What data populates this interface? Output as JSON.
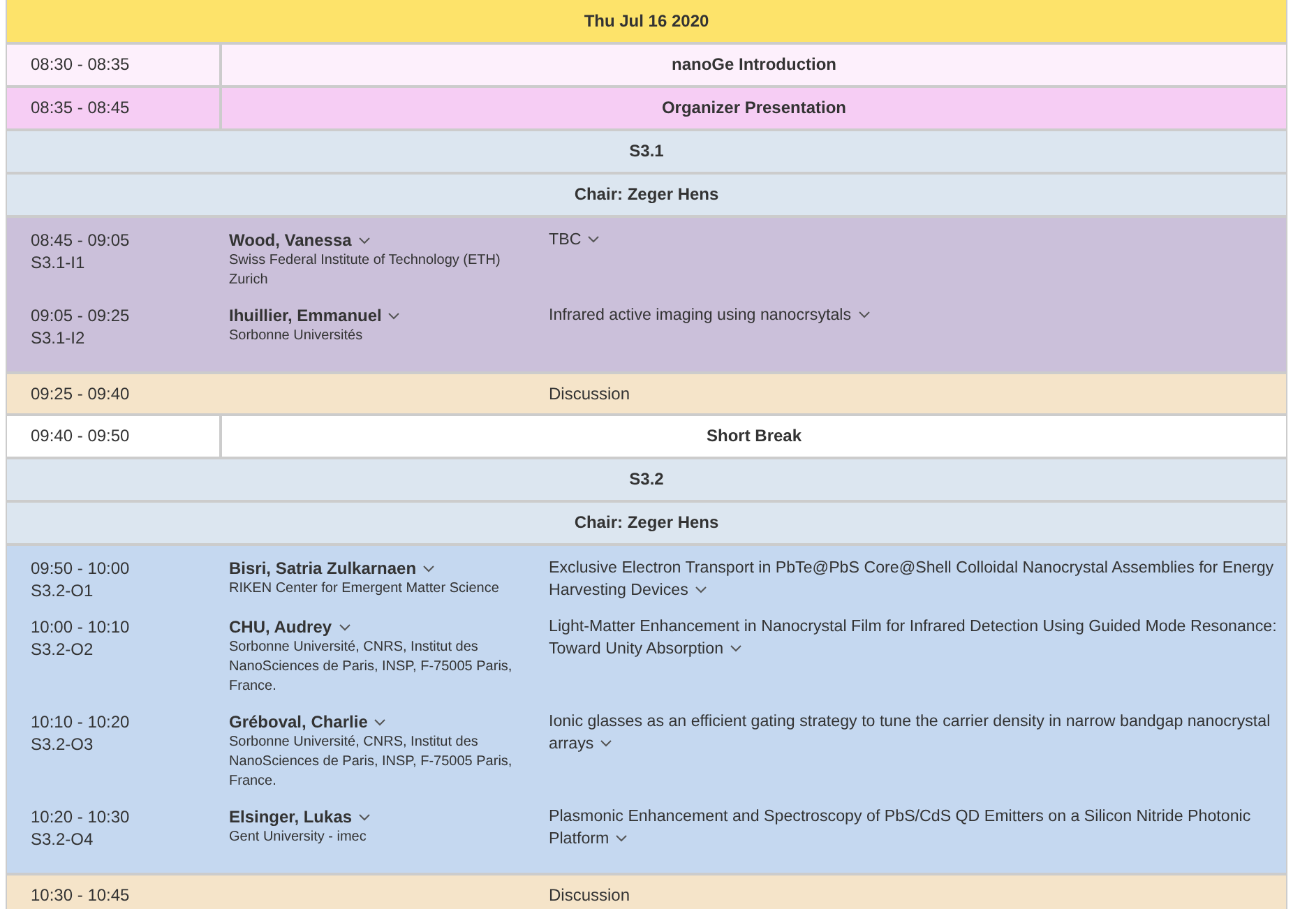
{
  "date": "Thu Jul 16 2020",
  "rows": [
    {
      "kind": "event",
      "time": "08:30 - 08:35",
      "title": "nanoGe Introduction",
      "color": "#fdf0fc"
    },
    {
      "kind": "event",
      "time": "08:35 - 08:45",
      "title": "Organizer Presentation",
      "color": "#f6cdf4"
    },
    {
      "kind": "section",
      "title": "S3.1",
      "color": "#dce6f0"
    },
    {
      "kind": "section",
      "title": "Chair: Zeger Hens",
      "color": "#dce6f0"
    },
    {
      "kind": "talks",
      "color": "#cbc0da",
      "talks": [
        {
          "time": "08:45 - 09:05",
          "code": "S3.1-I1",
          "speaker": "Wood, Vanessa",
          "affiliation": "Swiss Federal Institute of Technology (ETH) Zurich",
          "title": "TBC"
        },
        {
          "time": "09:05 - 09:25",
          "code": "S3.1-I2",
          "speaker": "Ihuillier, Emmanuel",
          "affiliation": "Sorbonne Universités",
          "title": "Infrared active imaging using nanocrsytals"
        }
      ]
    },
    {
      "kind": "discussion",
      "time": "09:25 - 09:40",
      "title": "Discussion",
      "color": "#f5e4c9"
    },
    {
      "kind": "event",
      "time": "09:40 - 09:50",
      "title": "Short Break",
      "color": "#ffffff"
    },
    {
      "kind": "section",
      "title": "S3.2",
      "color": "#dce6f0"
    },
    {
      "kind": "section",
      "title": "Chair: Zeger Hens",
      "color": "#dce6f0"
    },
    {
      "kind": "talks",
      "color": "#c5d8f0",
      "talks": [
        {
          "time": "09:50 - 10:00",
          "code": "S3.2-O1",
          "speaker": "Bisri, Satria Zulkarnaen",
          "affiliation": "RIKEN Center for Emergent Matter Science",
          "title": "Exclusive Electron Transport in PbTe@PbS Core@Shell Colloidal Nanocrystal Assemblies for Energy Harvesting Devices"
        },
        {
          "time": "10:00 - 10:10",
          "code": "S3.2-O2",
          "speaker": "CHU, Audrey",
          "affiliation": "Sorbonne Université, CNRS, Institut des NanoSciences de Paris, INSP, F-75005 Paris, France.",
          "title": "Light-Matter Enhancement in Nanocrystal Film for Infrared Detection Using Guided Mode Resonance: Toward Unity Absorption"
        },
        {
          "time": "10:10 - 10:20",
          "code": "S3.2-O3",
          "speaker": "Gréboval, Charlie",
          "affiliation": "Sorbonne Université, CNRS, Institut des NanoSciences de Paris, INSP, F-75005 Paris, France.",
          "title": "Ionic glasses as an efficient gating strategy to tune the carrier density in narrow bandgap nanocrystal arrays"
        },
        {
          "time": "10:20 - 10:30",
          "code": "S3.2-O4",
          "speaker": "Elsinger, Lukas",
          "affiliation": "Gent University - imec",
          "title": "Plasmonic Enhancement and Spectroscopy of PbS/CdS QD Emitters on a Silicon Nitride Photonic Platform"
        }
      ]
    },
    {
      "kind": "discussion",
      "time": "10:30 - 10:45",
      "title": "Discussion",
      "color": "#f5e4c9"
    }
  ]
}
